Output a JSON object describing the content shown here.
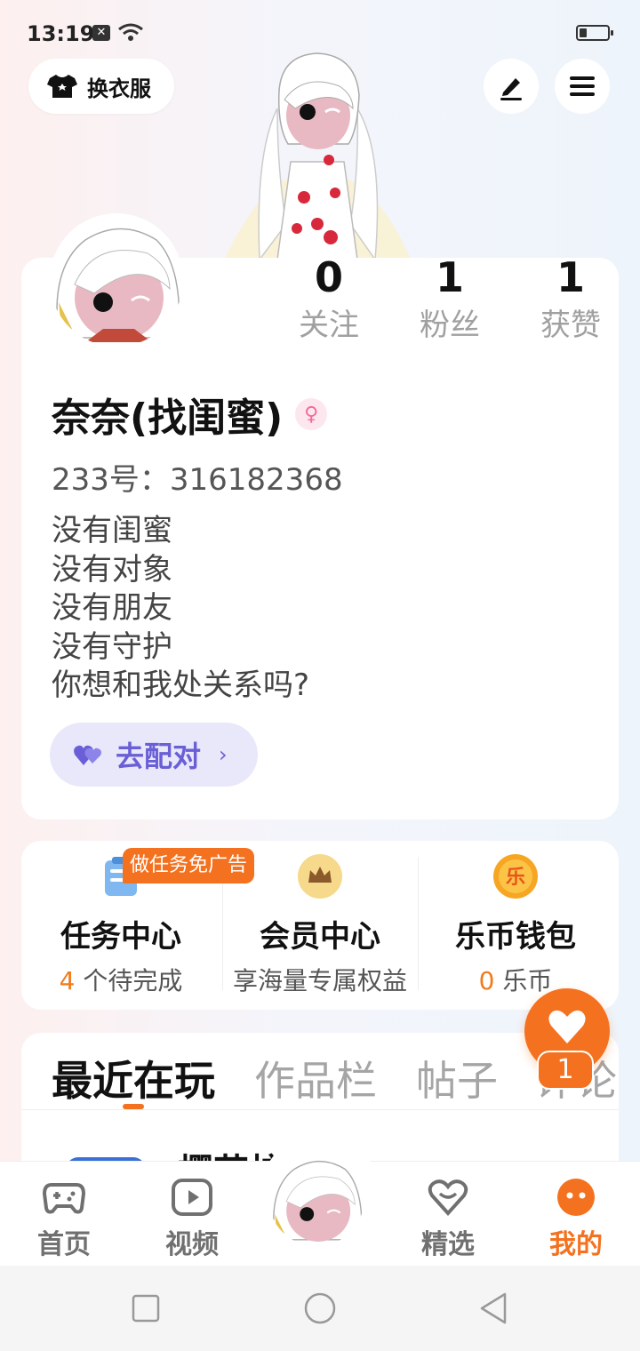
{
  "status_bar": {
    "time": "13:19"
  },
  "header": {
    "outfit_label": "换衣服",
    "edit_icon": "pencil-icon",
    "menu_icon": "hamburger-menu-icon"
  },
  "profile": {
    "stats": [
      {
        "num": "0",
        "label": "关注"
      },
      {
        "num": "1",
        "label": "粉丝"
      },
      {
        "num": "1",
        "label": "获赞"
      }
    ],
    "username": "奈奈(找闺蜜)",
    "gender_symbol": "♀",
    "uid": "233号：316182368",
    "bio": [
      "没有闺蜜",
      "没有对象",
      "没有朋友",
      "没有守护",
      "你想和我处关系吗?"
    ],
    "match_label": "去配对",
    "match_chevron": "›"
  },
  "features": {
    "task_badge": "做任务免广告",
    "items": [
      {
        "title": "任务中心",
        "sub_hl": "4",
        "sub": " 个待完成"
      },
      {
        "title": "会员中心",
        "sub_hl": "",
        "sub": "享海量专属权益"
      },
      {
        "title": "乐币钱包",
        "sub_hl": "0",
        "sub": " 乐币"
      }
    ],
    "coin_glyph": "乐"
  },
  "floating": {
    "count": "1"
  },
  "tabs": {
    "items": [
      "最近在玩",
      "作品栏",
      "帖子",
      "评论"
    ],
    "active": 0,
    "peek_text": "樱花校"
  },
  "bottom_nav": {
    "items": [
      {
        "label": "首页",
        "icon": "gamepad-icon"
      },
      {
        "label": "视频",
        "icon": "play-icon"
      },
      {
        "label": "",
        "icon": "avatar-center"
      },
      {
        "label": "精选",
        "icon": "heart-badge-icon"
      },
      {
        "label": "我的",
        "icon": "smile-face-icon"
      }
    ],
    "active": 4
  },
  "colors": {
    "accent": "#f4721f",
    "match": "#6a5fd6",
    "female": "#f26c9a"
  }
}
